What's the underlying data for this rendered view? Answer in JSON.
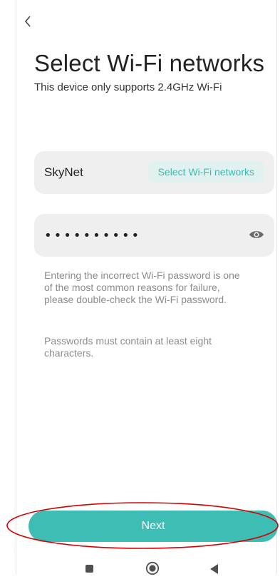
{
  "header": {
    "back_icon": "chevron-left-icon",
    "title": "Select Wi-Fi networks",
    "subtitle": "This device only supports 2.4GHz Wi-Fi"
  },
  "network": {
    "name": "SkyNet",
    "select_label": "Select Wi-Fi networks"
  },
  "password": {
    "value": "••••••••••",
    "toggle_icon": "eye-icon"
  },
  "hints": [
    "Entering the incorrect Wi-Fi password is one of the most common reasons for failure, please double-check the Wi-Fi password.",
    "Passwords must contain at least eight characters."
  ],
  "next_label": "Next",
  "nav_bar": {
    "recent_icon": "square-icon",
    "home_icon": "circle-icon",
    "back_icon": "triangle-left-icon"
  },
  "colors": {
    "accent": "#3dbdb4",
    "accent_light": "#e0f1ef",
    "field_bg": "#efefef",
    "highlight": "#d40000"
  }
}
